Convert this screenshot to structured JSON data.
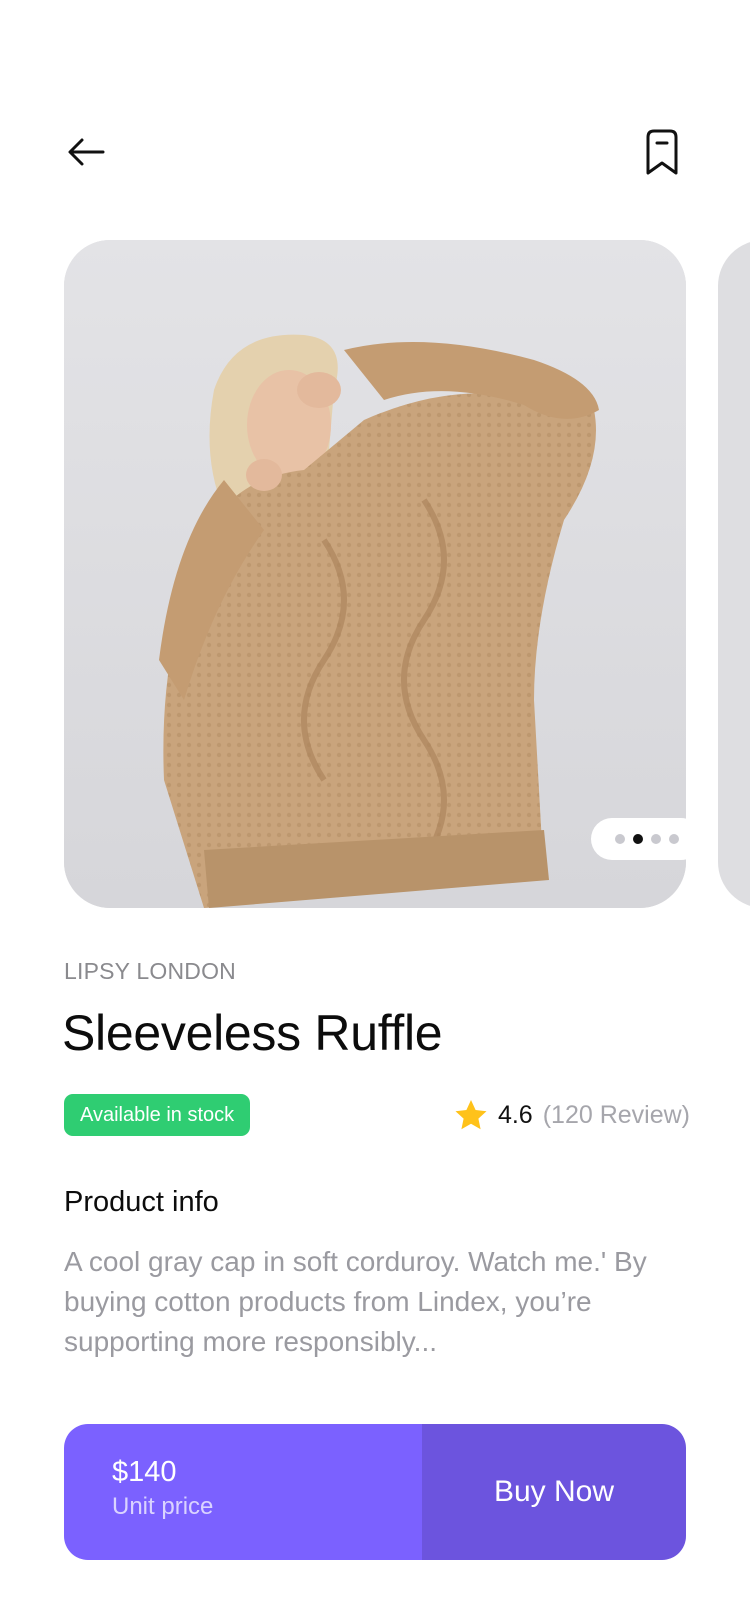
{
  "header": {
    "back_icon": "arrow-left-icon",
    "bookmark_icon": "bookmark-icon"
  },
  "carousel": {
    "active_index": 1,
    "dot_count": 4
  },
  "product": {
    "brand": "LIPSY LONDON",
    "name": "Sleeveless Ruffle",
    "stock_label": "Available in stock",
    "rating": "4.6",
    "reviews": "(120 Review)",
    "info_heading": "Product info",
    "description": "A cool gray cap in soft corduroy. Watch me.' By buying cotton products from Lindex, you’re supporting more responsibly..."
  },
  "cta": {
    "price": "$140",
    "price_label": "Unit price",
    "buy_label": "Buy Now"
  },
  "colors": {
    "accent": "#7b61ff",
    "accent_dark": "#6c54de",
    "success": "#2fcd72",
    "star": "#ffc21a",
    "muted": "#9a9aa0"
  }
}
